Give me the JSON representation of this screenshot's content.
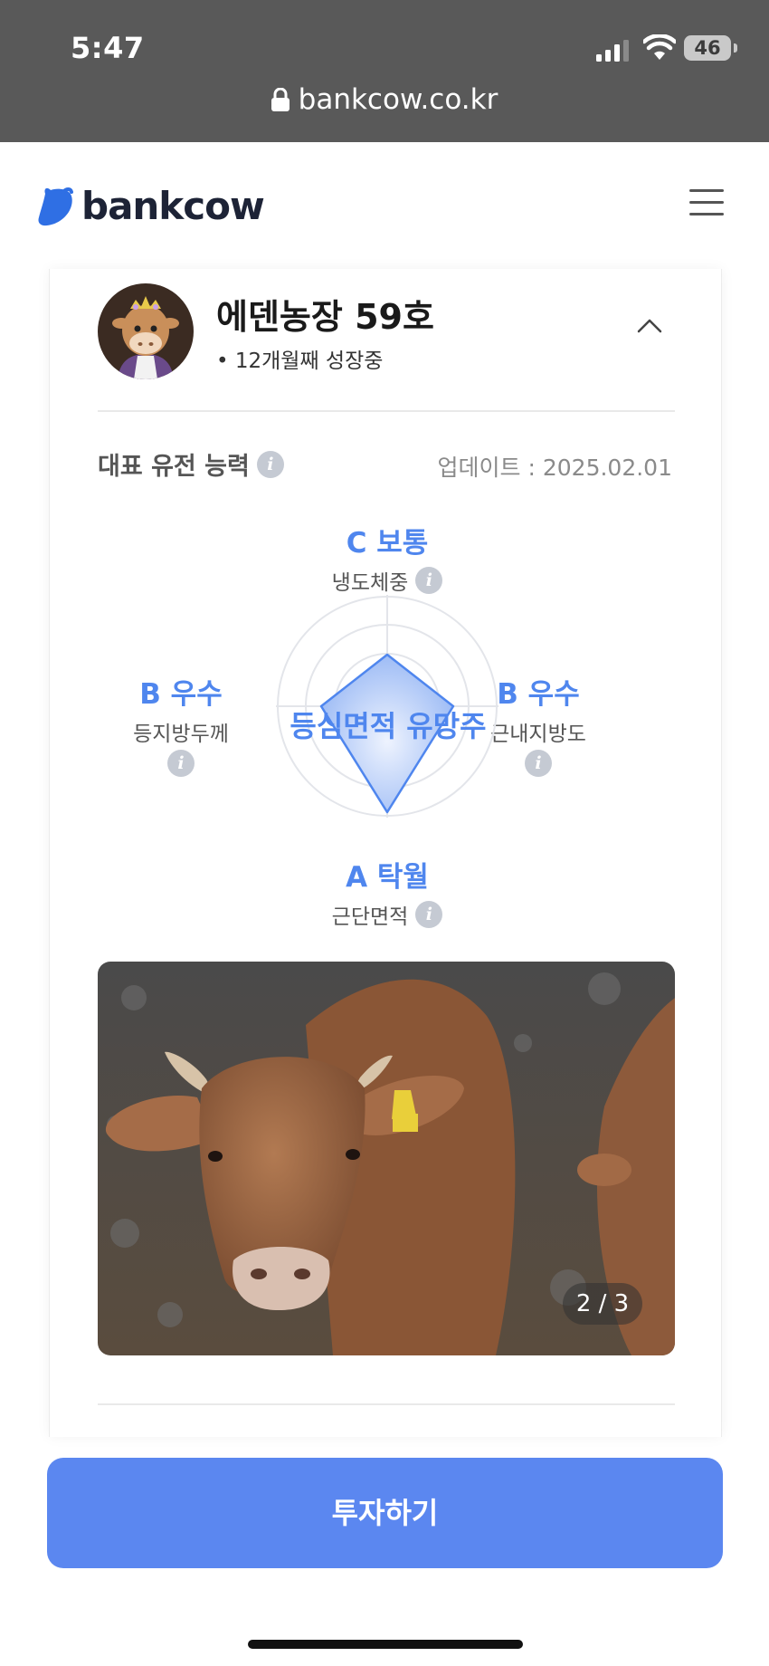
{
  "status_bar": {
    "time": "5:47",
    "battery": "46"
  },
  "browser": {
    "url": "bankcow.co.kr"
  },
  "site": {
    "logo_text": "bankcow"
  },
  "cattle": {
    "name": "에덴농장 59호",
    "status": "• 12개월째 성장중"
  },
  "genetics": {
    "title": "대표 유전 능력",
    "updated": "업데이트 : 2025.02.01",
    "center_label": "등심면적 유망주",
    "top": {
      "grade": "C 보통",
      "trait": "냉도체중"
    },
    "left": {
      "grade": "B 우수",
      "trait": "등지방두께"
    },
    "right": {
      "grade": "B 우수",
      "trait": "근내지방도"
    },
    "bottom": {
      "grade": "A 탁월",
      "trait": "근단면적"
    },
    "info_icon": "i"
  },
  "gallery": {
    "counter": "2 / 3"
  },
  "cta": {
    "invest_label": "투자하기"
  },
  "colors": {
    "accent": "#5b87f0",
    "grade": "#4f86ee",
    "topbar": "#595959"
  }
}
